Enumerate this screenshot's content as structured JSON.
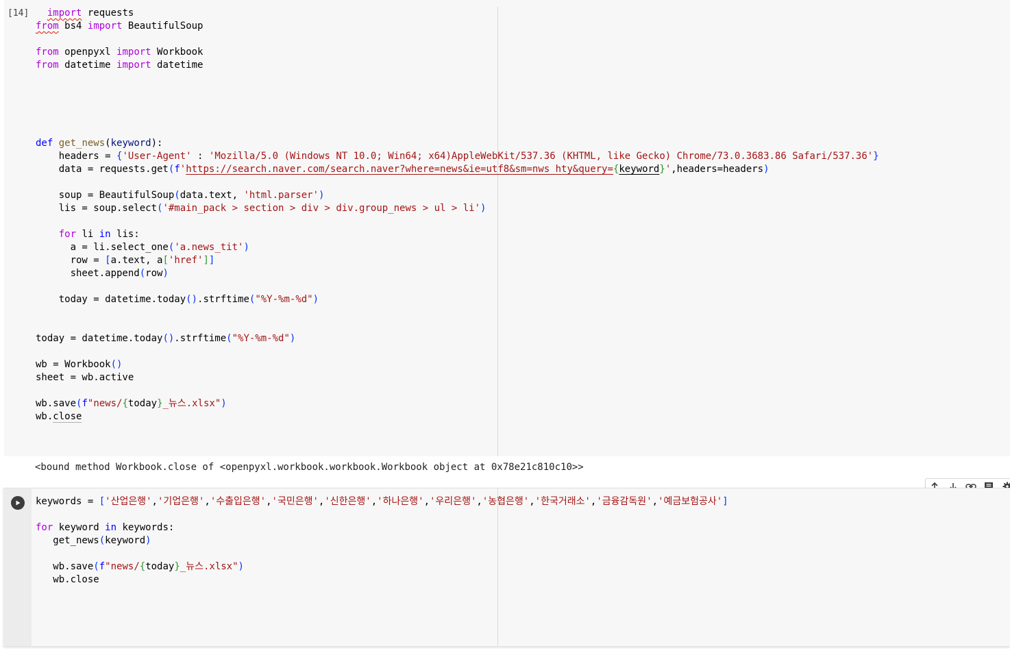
{
  "cell1": {
    "execution_count": "[14]",
    "code": {
      "import_requests": "requests",
      "bs4_module": "bs4",
      "beautifulsoup": "BeautifulSoup",
      "openpyxl_module": "openpyxl",
      "workbook_name": "Workbook",
      "datetime_name": "datetime",
      "func_name": "get_news",
      "param": "keyword",
      "headers_key": "'User-Agent'",
      "headers_value": "'Mozilla/5.0 (Windows NT 10.0; Win64; x64)AppleWebKit/537.36 (KHTML, like Gecko) Chrome/73.0.3683.86 Safari/537.36'",
      "url_prefix": "https://search.naver.com/search.naver?where=news&ie=utf8&sm=nws_hty&query=",
      "parser": "'html.parser'",
      "selector": "'#main_pack > section > div > div.group_news > ul > li'",
      "select_one": "'a.news_tit'",
      "href": "'href'",
      "date_format": "\"%Y-%m-%d\"",
      "save_path_start": "\"news/",
      "save_path_end": "_뉴스.xlsx\""
    }
  },
  "output1": {
    "text": "<bound method Workbook.close of <openpyxl.workbook.workbook.Workbook object at 0x78e21c810c10>>"
  },
  "cell2": {
    "code": {
      "keywords": [
        "'산업은행'",
        "'기업은행'",
        "'수출입은행'",
        "'국민은행'",
        "'신한은행'",
        "'하나은행'",
        "'우리은행'",
        "'농협은행'",
        "'한국거래소'",
        "'금융감독원'",
        "'예금보험공사'"
      ]
    }
  },
  "toolbar": {
    "icons": [
      "arrow-up-icon",
      "arrow-down-icon",
      "link-icon",
      "comment-icon",
      "gear-icon"
    ]
  }
}
